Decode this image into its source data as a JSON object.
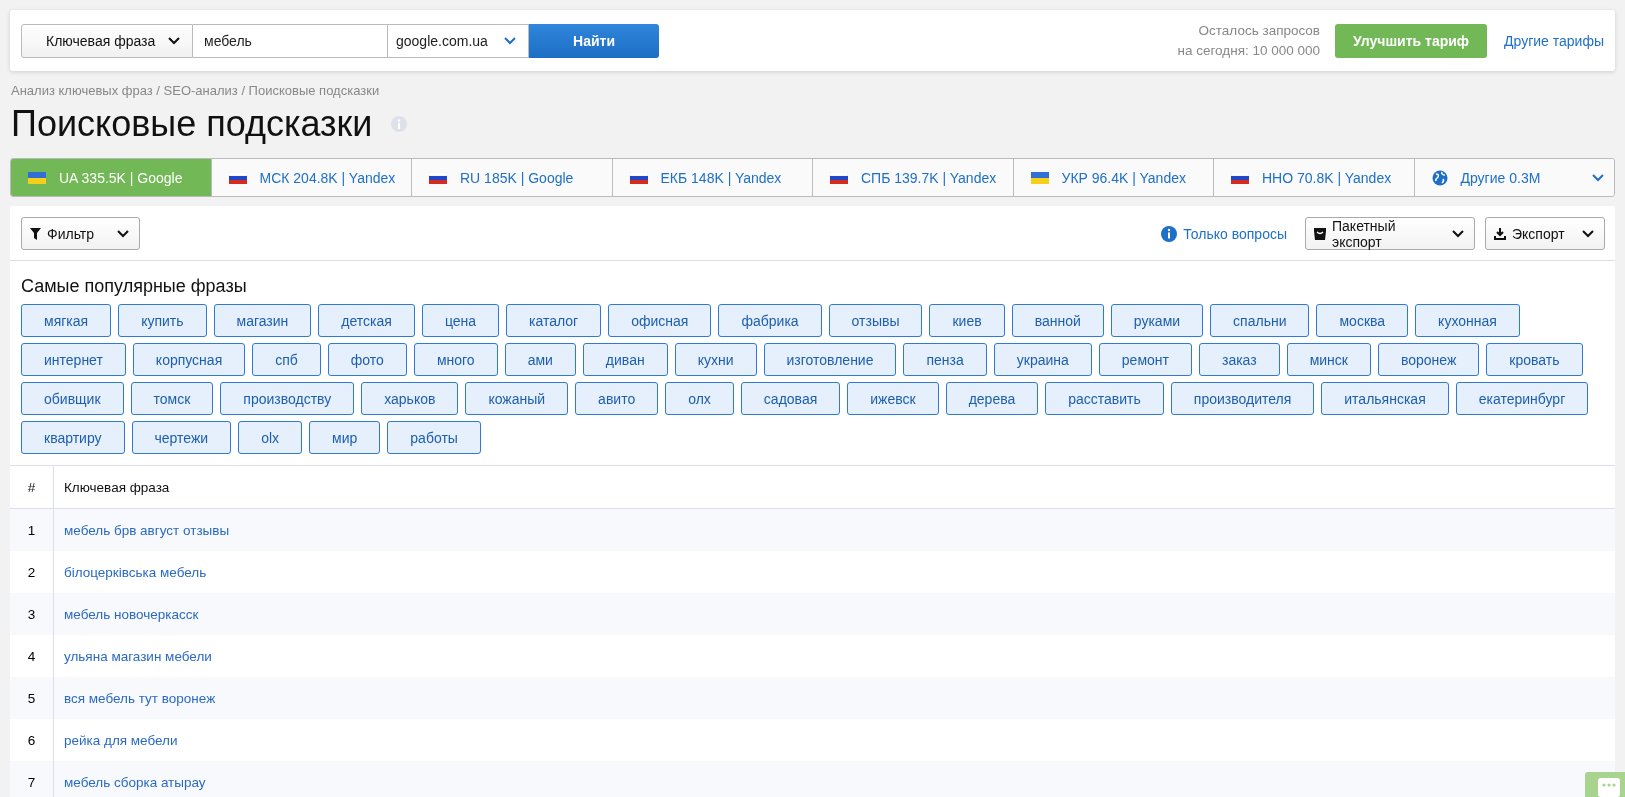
{
  "search_bar": {
    "mode_dropdown": "Ключевая фраза",
    "query": "мебель",
    "engine_dropdown": "google.com.ua",
    "search_button": "Найти"
  },
  "quota": {
    "line_1": "Осталось запросов",
    "line_2": "на сегодня: 10 000 000"
  },
  "upgrade_button": "Улучшить тариф",
  "other_plans_link": "Другие тарифы",
  "breadcrumb": "Анализ ключевых фраз / SEO-анализ / Поисковые подсказки",
  "page_title": "Поисковые подсказки",
  "tabs": [
    {
      "label": "UA 335.5K | Google",
      "kind": "ua",
      "selected": true
    },
    {
      "label": "МСК 204.8K | Yandex",
      "kind": "ru",
      "selected": false
    },
    {
      "label": "RU 185K | Google",
      "kind": "ru",
      "selected": false
    },
    {
      "label": "ЕКБ 148K | Yandex",
      "kind": "ru",
      "selected": false
    },
    {
      "label": "СПБ 139.7K | Yandex",
      "kind": "ru",
      "selected": false
    },
    {
      "label": "УКР 96.4K | Yandex",
      "kind": "ua",
      "selected": false
    },
    {
      "label": "ННО 70.8K | Yandex",
      "kind": "ru",
      "selected": false
    },
    {
      "label": "Другие 0.3M",
      "kind": "globe",
      "selected": false
    }
  ],
  "toolbar": {
    "filter": "Фильтр",
    "questions_only": "Только вопросы",
    "batch_export": "Пакетный экспорт",
    "export": "Экспорт"
  },
  "popular": {
    "title": "Самые популярные фразы",
    "tags": [
      "мягкая",
      "купить",
      "магазин",
      "детская",
      "цена",
      "каталог",
      "офисная",
      "фабрика",
      "отзывы",
      "киев",
      "ванной",
      "руками",
      "спальни",
      "москва",
      "кухонная",
      "интернет",
      "корпусная",
      "спб",
      "фото",
      "много",
      "ами",
      "диван",
      "кухни",
      "изготовление",
      "пенза",
      "украина",
      "ремонт",
      "заказ",
      "минск",
      "воронеж",
      "кровать",
      "обивщик",
      "томск",
      "производству",
      "харьков",
      "кожаный",
      "авито",
      "олх",
      "садовая",
      "ижевск",
      "дерева",
      "расставить",
      "производителя",
      "итальянская",
      "екатеринбург",
      "квартиру",
      "чертежи",
      "olx",
      "мир",
      "работы"
    ]
  },
  "table": {
    "columns": [
      "#",
      "Ключевая фраза"
    ],
    "rows": [
      [
        "1",
        "мебель брв август отзывы"
      ],
      [
        "2",
        "білоцерківська мебель"
      ],
      [
        "3",
        "мебель новочеркасск"
      ],
      [
        "4",
        "ульяна магазин мебели"
      ],
      [
        "5",
        "вся мебель тут воронеж"
      ],
      [
        "6",
        "рейка для мебели"
      ],
      [
        "7",
        "мебель сборка атырау"
      ]
    ]
  }
}
